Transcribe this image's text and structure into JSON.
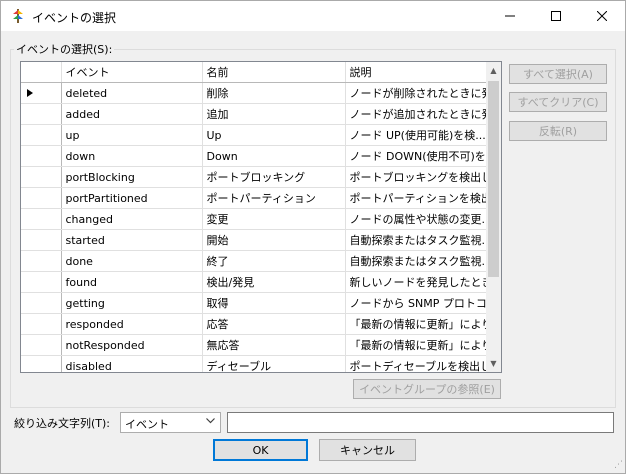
{
  "window": {
    "title": "イベントの選択"
  },
  "icons": {
    "app": "app-icon",
    "minimize": "minimize-icon",
    "maximize": "maximize-icon",
    "close": "close-icon"
  },
  "group": {
    "label": "イベントの選択(S):"
  },
  "grid": {
    "columns": [
      "イベント",
      "名前",
      "説明"
    ],
    "current_row": 0,
    "rows": [
      {
        "event": "deleted",
        "name": "削除",
        "desc": "ノードが削除されたときに発..."
      },
      {
        "event": "added",
        "name": "追加",
        "desc": "ノードが追加されたときに発..."
      },
      {
        "event": "up",
        "name": "Up",
        "desc": "ノード UP(使用可能)を検..."
      },
      {
        "event": "down",
        "name": "Down",
        "desc": "ノード DOWN(使用不可)を..."
      },
      {
        "event": "portBlocking",
        "name": "ポートブロッキング",
        "desc": "ポートブロッキングを検出し..."
      },
      {
        "event": "portPartitioned",
        "name": "ポートパーティション",
        "desc": "ポートパーティションを検出..."
      },
      {
        "event": "changed",
        "name": "変更",
        "desc": "ノードの属性や状態の変更..."
      },
      {
        "event": "started",
        "name": "開始",
        "desc": "自動探索またはタスク監視..."
      },
      {
        "event": "done",
        "name": "終了",
        "desc": "自動探索またはタスク監視..."
      },
      {
        "event": "found",
        "name": "検出/発見",
        "desc": "新しいノードを発見したとき..."
      },
      {
        "event": "getting",
        "name": "取得",
        "desc": "ノードから SNMP プロトコル..."
      },
      {
        "event": "responded",
        "name": "応答",
        "desc": "「最新の情報に更新」により..."
      },
      {
        "event": "notResponded",
        "name": "無応答",
        "desc": "「最新の情報に更新」により..."
      },
      {
        "event": "disabled",
        "name": "ディセーブル",
        "desc": "ポートディセーブルを検出し..."
      }
    ]
  },
  "buttons": {
    "select_all": "すべて選択(A)",
    "clear_all": "すべてクリア(C)",
    "invert": "反転(R)",
    "group_ref": "イベントグループの参照(E)",
    "ok": "OK",
    "cancel": "キャンセル"
  },
  "filter": {
    "label": "絞り込み文字列(T):",
    "selected": "イベント",
    "value": ""
  }
}
